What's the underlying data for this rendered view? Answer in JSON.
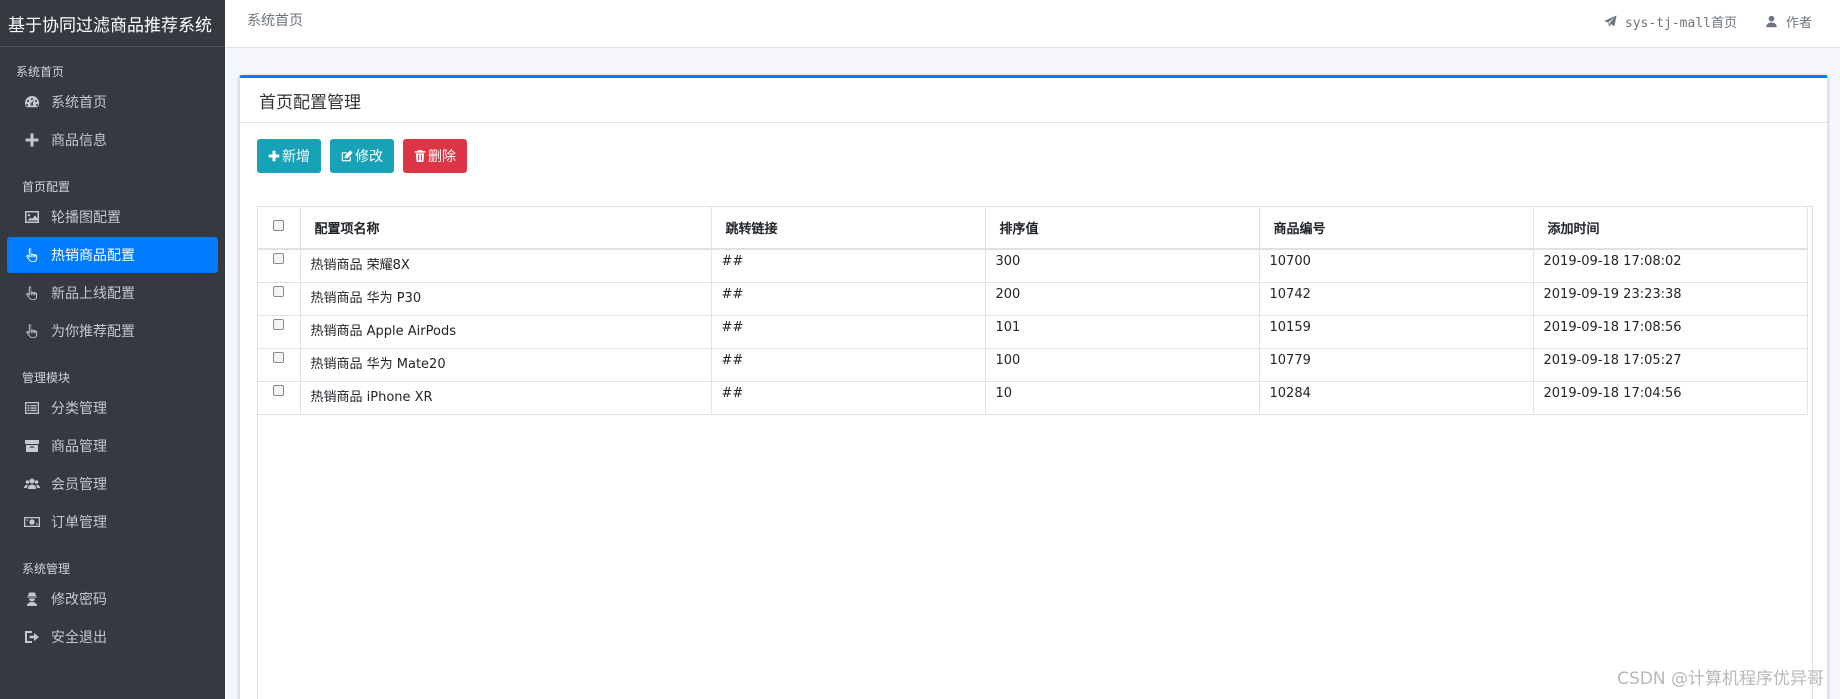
{
  "brand": {
    "title": "基于协同过滤商品推荐系统"
  },
  "sidebar": {
    "groups": [
      {
        "header": "系统首页",
        "items": [
          {
            "label": "系统首页",
            "icon": "dashboard-icon"
          },
          {
            "label": "商品信息",
            "icon": "plus-icon"
          }
        ]
      },
      {
        "header": "首页配置",
        "items": [
          {
            "label": "轮播图配置",
            "icon": "image-icon"
          },
          {
            "label": "热销商品配置",
            "icon": "hand-pointer-icon",
            "active": true
          },
          {
            "label": "新品上线配置",
            "icon": "hand-pointer-icon"
          },
          {
            "label": "为你推荐配置",
            "icon": "hand-pointer-icon"
          }
        ]
      },
      {
        "header": "管理模块",
        "items": [
          {
            "label": "分类管理",
            "icon": "list-icon"
          },
          {
            "label": "商品管理",
            "icon": "archive-icon"
          },
          {
            "label": "会员管理",
            "icon": "users-icon"
          },
          {
            "label": "订单管理",
            "icon": "money-bill-icon"
          }
        ]
      },
      {
        "header": "系统管理",
        "items": [
          {
            "label": "修改密码",
            "icon": "user-secret-icon"
          },
          {
            "label": "安全退出",
            "icon": "sign-out-icon"
          }
        ]
      }
    ]
  },
  "topbar": {
    "home": "系统首页",
    "mall_link": "sys-tj-mall首页",
    "author": "作者"
  },
  "card": {
    "title": "首页配置管理",
    "buttons": {
      "add": "新增",
      "edit": "修改",
      "delete": "删除"
    }
  },
  "table": {
    "columns": [
      "配置项名称",
      "跳转链接",
      "排序值",
      "商品编号",
      "添加时间"
    ],
    "rows": [
      [
        "热销商品 荣耀8X",
        "##",
        "300",
        "10700",
        "2019-09-18 17:08:02"
      ],
      [
        "热销商品 华为 P30",
        "##",
        "200",
        "10742",
        "2019-09-19 23:23:38"
      ],
      [
        "热销商品 Apple AirPods",
        "##",
        "101",
        "10159",
        "2019-09-18 17:08:56"
      ],
      [
        "热销商品 华为 Mate20",
        "##",
        "100",
        "10779",
        "2019-09-18 17:05:27"
      ],
      [
        "热销商品 iPhone XR",
        "##",
        "10",
        "10284",
        "2019-09-18 17:04:56"
      ]
    ]
  },
  "watermark": "CSDN @计算机程序优异哥",
  "colors": {
    "sidebar": "#343a40",
    "active": "#007bff",
    "info": "#17a2b8",
    "danger": "#dc3545"
  }
}
